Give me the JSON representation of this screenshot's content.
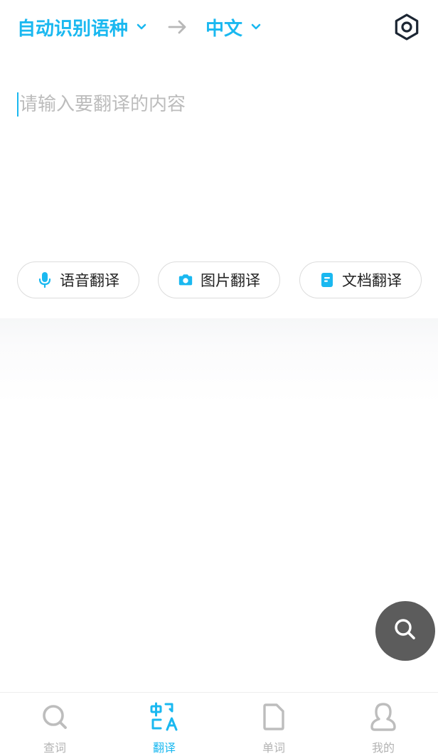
{
  "header": {
    "source_lang": "自动识别语种",
    "target_lang": "中文",
    "icons": {
      "dropdown": "chevron-down-icon",
      "swap": "arrow-right-icon",
      "settings": "hexagon-settings-icon"
    },
    "accent_color": "#1ab8f0"
  },
  "input": {
    "placeholder": "请输入要翻译的内容",
    "value": ""
  },
  "actions": [
    {
      "label": "语音翻译",
      "icon": "microphone-icon"
    },
    {
      "label": "图片翻译",
      "icon": "camera-icon"
    },
    {
      "label": "文档翻译",
      "icon": "document-icon"
    }
  ],
  "fab": {
    "icon": "search-icon"
  },
  "tabbar": {
    "tabs": [
      {
        "label": "查词",
        "icon": "search-icon",
        "active": false
      },
      {
        "label": "翻译",
        "icon": "translate-icon",
        "active": true
      },
      {
        "label": "单词",
        "icon": "file-icon",
        "active": false
      },
      {
        "label": "我的",
        "icon": "person-icon",
        "active": false
      }
    ]
  }
}
